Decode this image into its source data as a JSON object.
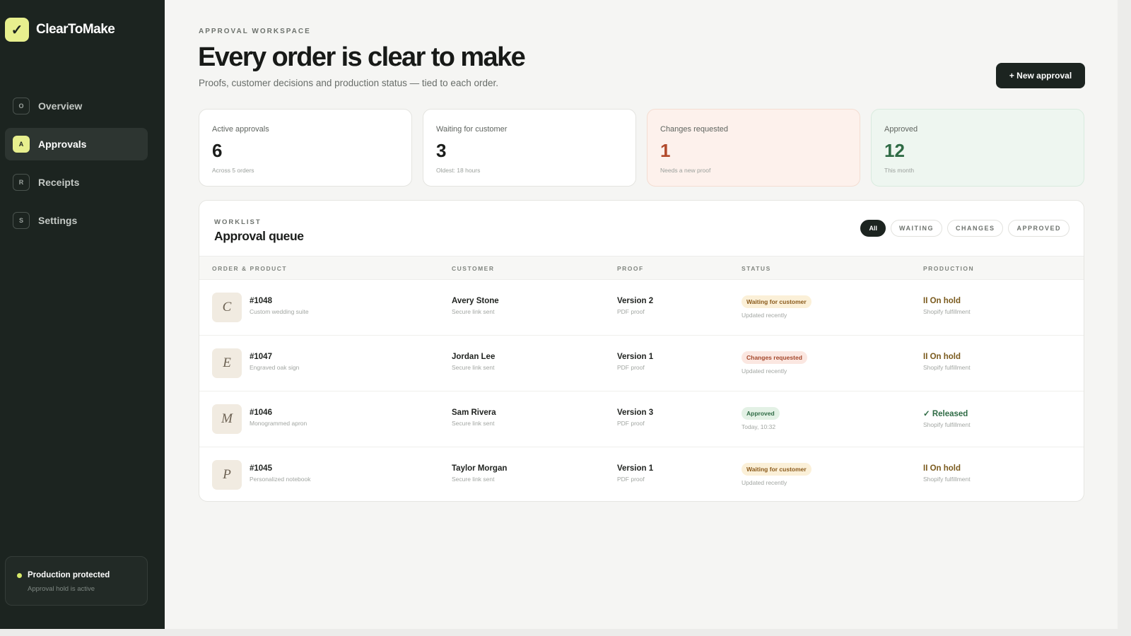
{
  "brand": {
    "name": "ClearToMake",
    "icon": "check-icon"
  },
  "sidebar": {
    "items": [
      {
        "key": "O",
        "label": "Overview",
        "active": false
      },
      {
        "key": "A",
        "label": "Approvals",
        "active": true
      },
      {
        "key": "R",
        "label": "Receipts",
        "active": false
      },
      {
        "key": "S",
        "label": "Settings",
        "active": false
      }
    ],
    "status": {
      "title": "Production protected",
      "subtitle": "Approval hold is active"
    }
  },
  "header": {
    "eyebrow": "APPROVAL WORKSPACE",
    "title": "Every order is clear to make",
    "subtitle": "Proofs, customer decisions and production status — tied to each order.",
    "new_button": "+ New approval"
  },
  "stats": [
    {
      "label": "Active approvals",
      "value": "6",
      "note": "Across 5 orders"
    },
    {
      "label": "Waiting for customer",
      "value": "3",
      "note": "Oldest: 18 hours"
    },
    {
      "label": "Changes requested",
      "value": "1",
      "note": "Needs a new proof"
    },
    {
      "label": "Approved",
      "value": "12",
      "note": "This month"
    }
  ],
  "worklist": {
    "eyebrow": "WORKLIST",
    "title": "Approval queue",
    "filters": [
      "All",
      "WAITING",
      "CHANGES",
      "APPROVED"
    ],
    "columns": [
      "ORDER & PRODUCT",
      "CUSTOMER",
      "PROOF",
      "STATUS",
      "PRODUCTION"
    ],
    "rows": [
      {
        "initial": "C",
        "order": "#1048",
        "product": "Custom wedding suite",
        "customer": "Avery Stone",
        "customer_note": "Secure link sent",
        "proof": "Version 2",
        "proof_type": "PDF proof",
        "status": "Waiting for customer",
        "status_note": "Updated recently",
        "production": "II On hold",
        "production_note": "Shopify fulfillment"
      },
      {
        "initial": "E",
        "order": "#1047",
        "product": "Engraved oak sign",
        "customer": "Jordan Lee",
        "customer_note": "Secure link sent",
        "proof": "Version 1",
        "proof_type": "PDF proof",
        "status": "Changes requested",
        "status_note": "Updated recently",
        "production": "II On hold",
        "production_note": "Shopify fulfillment"
      },
      {
        "initial": "M",
        "order": "#1046",
        "product": "Monogrammed apron",
        "customer": "Sam Rivera",
        "customer_note": "Secure link sent",
        "proof": "Version 3",
        "proof_type": "PDF proof",
        "status": "Approved",
        "status_note": "Today, 10:32",
        "production": "✓ Released",
        "production_note": "Shopify fulfillment"
      },
      {
        "initial": "P",
        "order": "#1045",
        "product": "Personalized notebook",
        "customer": "Taylor Morgan",
        "customer_note": "Secure link sent",
        "proof": "Version 1",
        "proof_type": "PDF proof",
        "status": "Waiting for customer",
        "status_note": "Updated recently",
        "production": "II On hold",
        "production_note": "Shopify fulfillment"
      }
    ]
  },
  "colors": {
    "sidebar": "#1c2420",
    "accent": "#e7ef8e",
    "changes": "#b24a2c",
    "approved": "#2f6b45",
    "waiting": "#8a5a1b"
  }
}
